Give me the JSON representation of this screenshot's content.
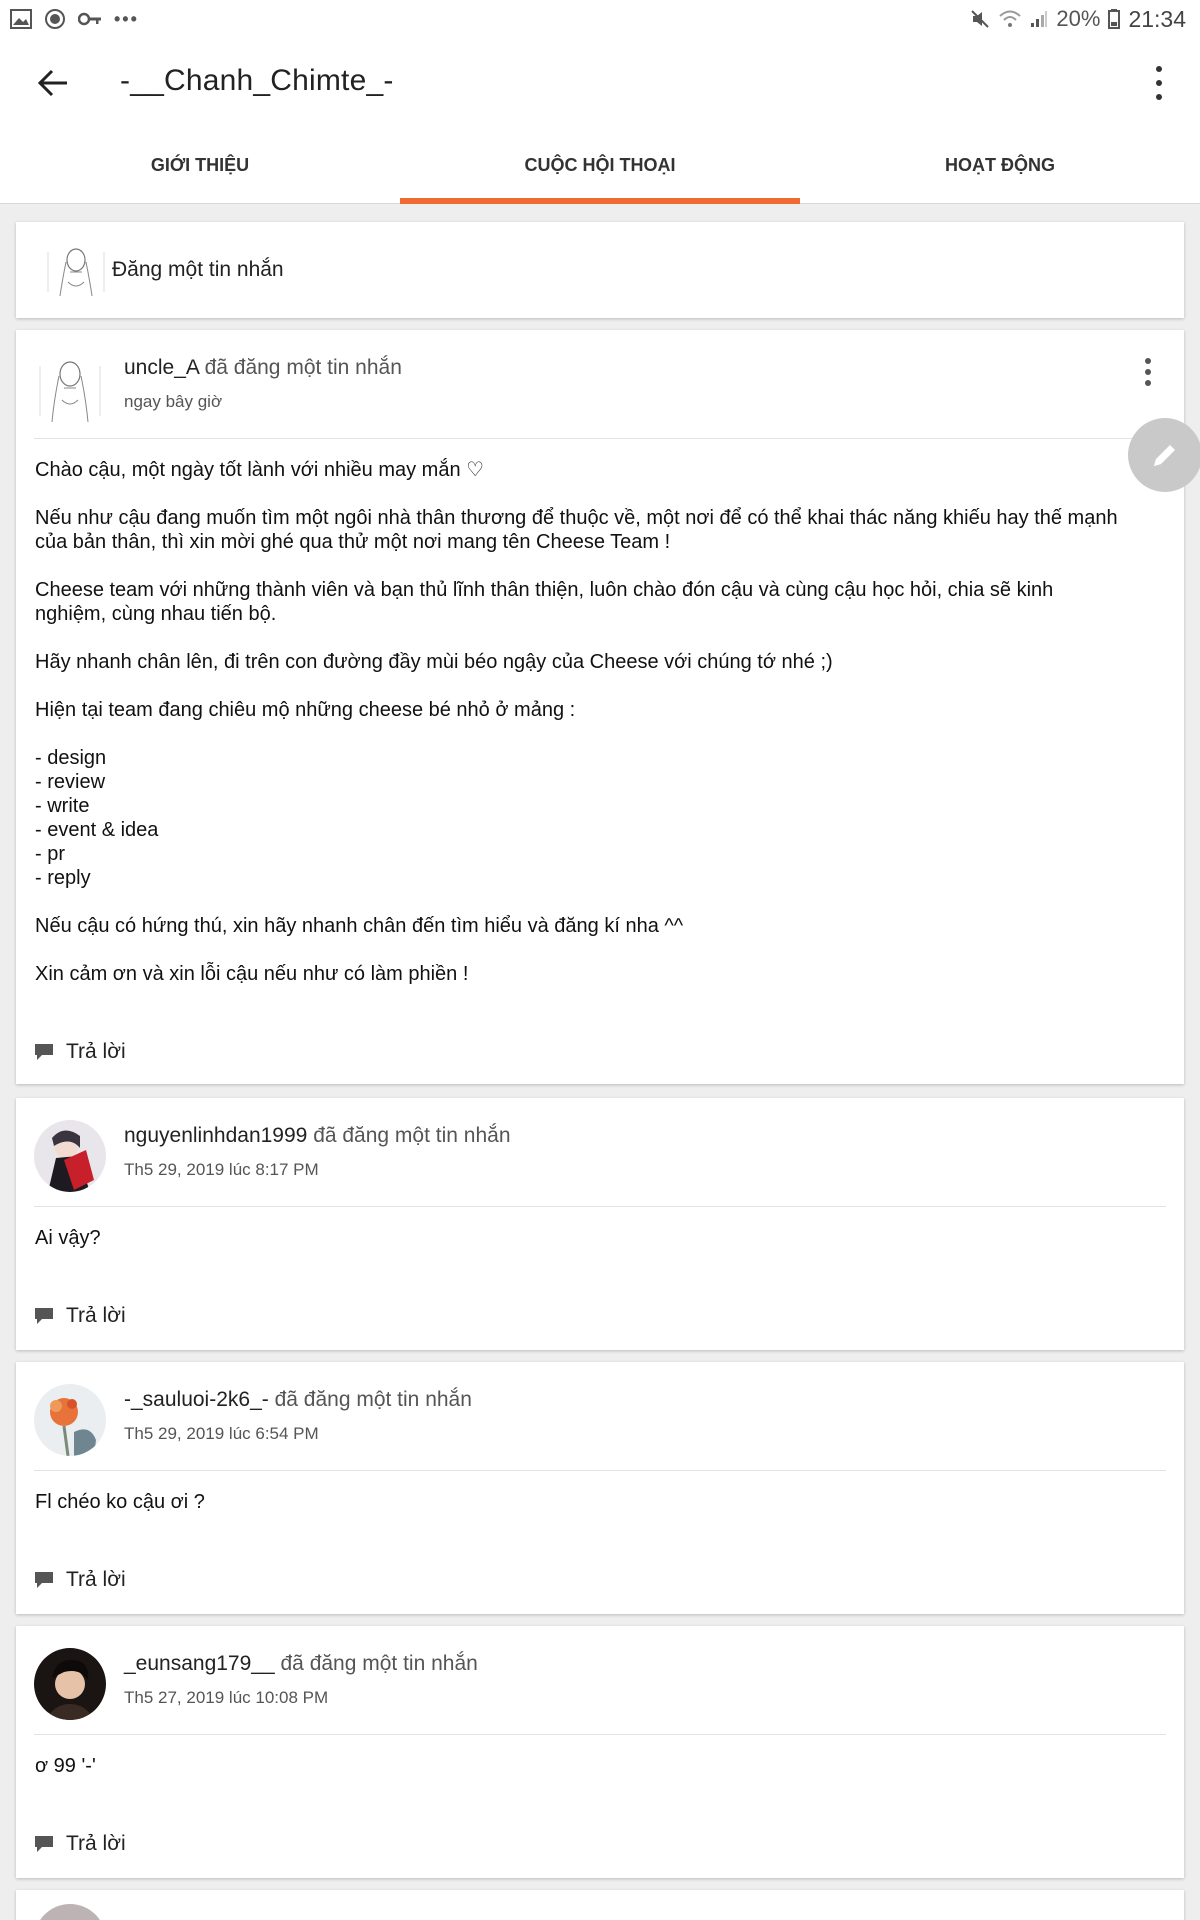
{
  "status_bar": {
    "battery_percent": "20%",
    "time": "21:34",
    "overflow_dots": "•••"
  },
  "app_bar": {
    "title": "-__Chanh_Chimte_-"
  },
  "tabs": [
    {
      "label": "GIỚI THIỆU",
      "active": false
    },
    {
      "label": "CUỘC HỘI THOẠI",
      "active": true
    },
    {
      "label": "HOẠT ĐỘNG",
      "active": false
    }
  ],
  "compose": {
    "label": "Đăng một tin nhắn"
  },
  "reply_label": "Trả lời",
  "posts": [
    {
      "username": "uncle_A",
      "action": "đã đăng một tin nhắn",
      "time": "ngay bây giờ",
      "body": "Chào cậu, một ngày tốt lành với nhiều may mắn ♡\n\nNếu như cậu đang muốn tìm một ngôi nhà thân thương để thuộc về, một nơi để có thể khai thác năng khiếu hay thế mạnh của bản thân, thì xin mời ghé qua thử một nơi mang tên Cheese Team !\n\nCheese team với những thành viên và bạn thủ lĩnh thân thiện, luôn chào đón cậu và cùng cậu học hỏi, chia sẽ kinh nghiệm, cùng nhau tiến bộ.\n\nHãy nhanh chân lên, đi trên con đường đầy mùi béo ngậy của Cheese với chúng tớ nhé ;)\n\nHiện tại team đang chiêu mộ những cheese bé nhỏ ở mảng :\n\n- design\n- review\n- write\n- event & idea\n- pr\n- reply\n\nNếu cậu có hứng thú, xin hãy nhanh chân đến tìm hiểu và đăng kí nha ^^\n\nXin cảm ơn và xin lỗi cậu nếu như có làm phiền !"
    },
    {
      "username": "nguyenlinhdan1999",
      "action": "đã đăng một tin nhắn",
      "time": "Th5 29, 2019 lúc 8:17 PM",
      "body": "Ai vậy?"
    },
    {
      "username": "-_sauluoi-2k6_-",
      "action": "đã đăng một tin nhắn",
      "time": "Th5 29, 2019 lúc 6:54 PM",
      "body": "Fl chéo ko cậu ơi  ?"
    },
    {
      "username": "_eunsang179__",
      "action": "đã đăng một tin nhắn",
      "time": "Th5 27, 2019 lúc 10:08 PM",
      "body": "ơ 99 '-'"
    }
  ],
  "colors": {
    "accent": "#f06a33",
    "fab": "#c9c9c9",
    "background": "#eeeeee"
  }
}
